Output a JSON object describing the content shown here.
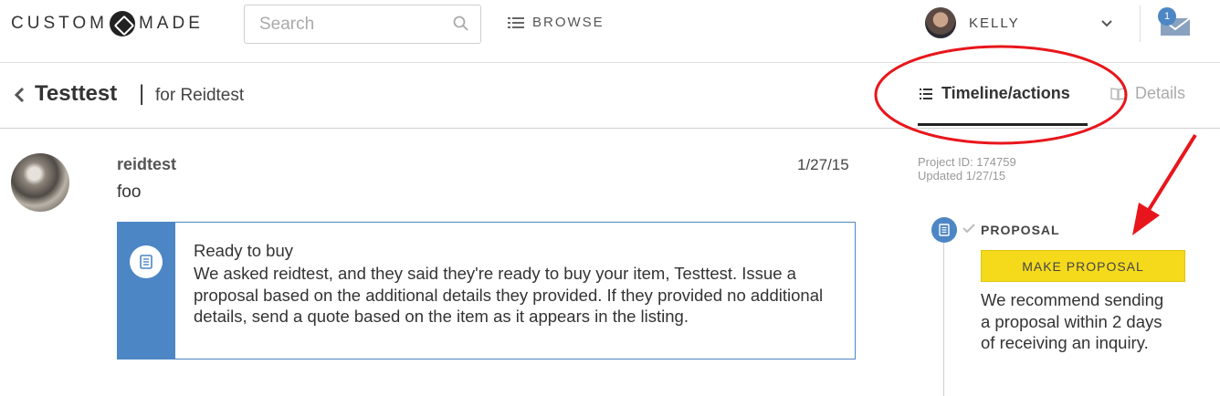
{
  "header": {
    "logo_left": "CUSTOM",
    "logo_right": "MADE",
    "search_placeholder": "Search",
    "browse_label": "BROWSE",
    "username": "KELLY",
    "notification_count": "1"
  },
  "project": {
    "title": "Testtest",
    "separator": "|",
    "for_label": "for Reidtest"
  },
  "tabs": {
    "timeline_label": "Timeline/actions",
    "details_label": "Details"
  },
  "message": {
    "user": "reidtest",
    "text": "foo",
    "date": "1/27/15",
    "card_title": "Ready to buy",
    "card_body": "We asked reidtest, and they said they're ready to buy your item, Testtest. Issue a proposal based on the additional details they provided. If they provided no additional details, send a quote based on the item as it appears in the listing."
  },
  "sidebar": {
    "project_id": "Project ID: 174759",
    "updated": "Updated 1/27/15",
    "step_label": "PROPOSAL",
    "button_label": "MAKE PROPOSAL",
    "recommendation": "We recommend sending a proposal within 2 days of receiving an inquiry."
  },
  "colors": {
    "accent_blue": "#4d86c4",
    "button_yellow": "#f5da1c",
    "annotation_red": "#e8161c"
  },
  "icons": [
    "search-icon",
    "list-icon",
    "chevron-down-icon",
    "mail-icon",
    "back-chevron-icon",
    "book-icon",
    "document-icon",
    "check-icon"
  ]
}
